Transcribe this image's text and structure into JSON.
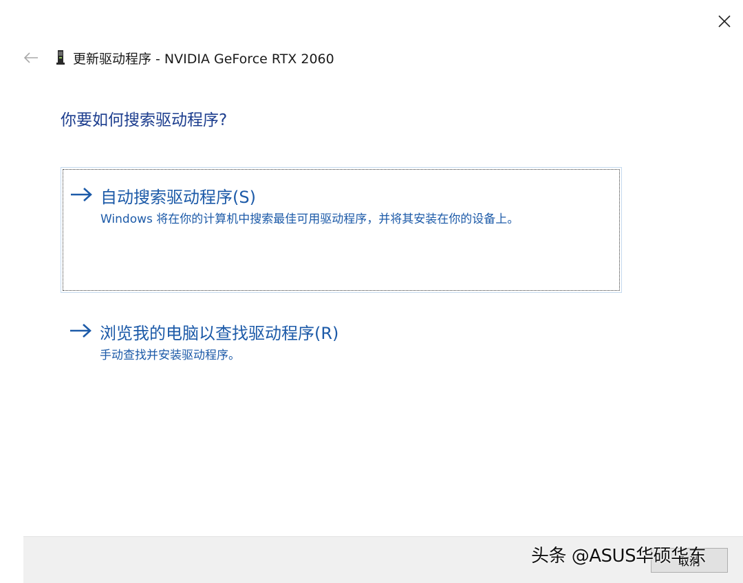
{
  "window": {
    "title": "更新驱动程序 - NVIDIA GeForce RTX 2060",
    "device_icon": "graphics-card-icon",
    "back_icon": "back-arrow-icon",
    "close_icon": "close-icon"
  },
  "main": {
    "question": "你要如何搜索驱动程序?",
    "options": [
      {
        "title": "自动搜索驱动程序(S)",
        "description": "Windows 将在你的计算机中搜索最佳可用驱动程序，并将其安装在你的设备上。",
        "icon": "arrow-right-icon",
        "focused": true
      },
      {
        "title": "浏览我的电脑以查找驱动程序(R)",
        "description": "手动查找并安装驱动程序。",
        "icon": "arrow-right-icon",
        "focused": false
      }
    ]
  },
  "footer": {
    "cancel_label": "取消"
  },
  "watermark": {
    "text": "头条 @ASUS华硕华东"
  },
  "colors": {
    "link_blue": "#1c5aa8",
    "heading_blue": "#1c3d8e",
    "footer_bg": "#f0f0f0"
  }
}
